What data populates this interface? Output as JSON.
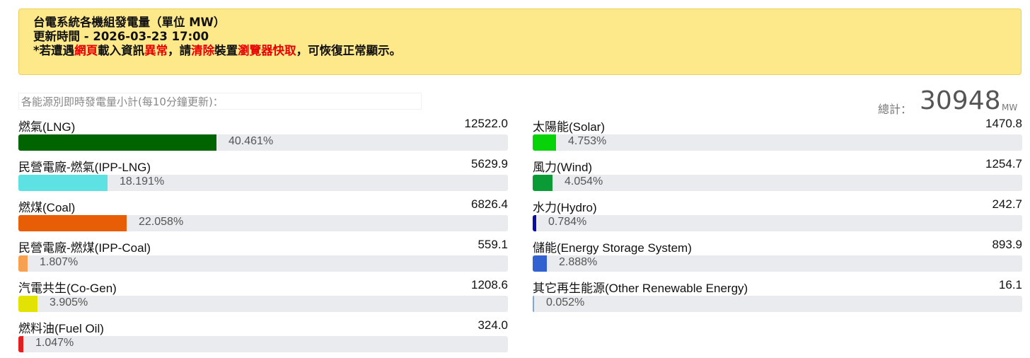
{
  "notice": {
    "title": "台電系統各機組發電量（單位 MW）",
    "updated": "更新時間 - 2026-03-23 17:00",
    "hint_parts": [
      {
        "text": "*若遭遇",
        "red": false
      },
      {
        "text": "網頁",
        "red": true
      },
      {
        "text": "載入資訊",
        "red": false
      },
      {
        "text": "異常",
        "red": true
      },
      {
        "text": "，請",
        "red": false
      },
      {
        "text": "清除",
        "red": true
      },
      {
        "text": "裝置",
        "red": false
      },
      {
        "text": "瀏覽器快取",
        "red": true
      },
      {
        "text": "，可恢復正常顯示。",
        "red": false
      }
    ]
  },
  "summary": {
    "subtitle": "各能源別即時發電量小計(每10分鐘更新)：",
    "total_label": "總計：",
    "total_value": "30948",
    "total_unit": "MW"
  },
  "sources_left": [
    {
      "name": "燃氣(LNG)",
      "value": "12522.0",
      "percent": 40.461,
      "percent_label": "40.461%",
      "color": "#006400"
    },
    {
      "name": "民營電廠-燃氣(IPP-LNG)",
      "value": "5629.9",
      "percent": 18.191,
      "percent_label": "18.191%",
      "color": "#5ee1e3"
    },
    {
      "name": "燃煤(Coal)",
      "value": "6826.4",
      "percent": 22.058,
      "percent_label": "22.058%",
      "color": "#e85e07"
    },
    {
      "name": "民營電廠-燃煤(IPP-Coal)",
      "value": "559.1",
      "percent": 1.807,
      "percent_label": "1.807%",
      "color": "#f7a04f"
    },
    {
      "name": "汽電共生(Co-Gen)",
      "value": "1208.6",
      "percent": 3.905,
      "percent_label": "3.905%",
      "color": "#e2e205"
    },
    {
      "name": "燃料油(Fuel Oil)",
      "value": "324.0",
      "percent": 1.047,
      "percent_label": "1.047%",
      "color": "#e41e1e"
    }
  ],
  "sources_right": [
    {
      "name": "太陽能(Solar)",
      "value": "1470.8",
      "percent": 4.753,
      "percent_label": "4.753%",
      "color": "#08d208"
    },
    {
      "name": "風力(Wind)",
      "value": "1254.7",
      "percent": 4.054,
      "percent_label": "4.054%",
      "color": "#0a9b37"
    },
    {
      "name": "水力(Hydro)",
      "value": "242.7",
      "percent": 0.784,
      "percent_label": "0.784%",
      "color": "#0b0ba8"
    },
    {
      "name": "儲能(Energy Storage System)",
      "value": "893.9",
      "percent": 2.888,
      "percent_label": "2.888%",
      "color": "#3162cf"
    },
    {
      "name": "其它再生能源(Other Renewable Energy)",
      "value": "16.1",
      "percent": 0.052,
      "percent_label": "0.052%",
      "color": "#7fa7d6"
    }
  ]
}
